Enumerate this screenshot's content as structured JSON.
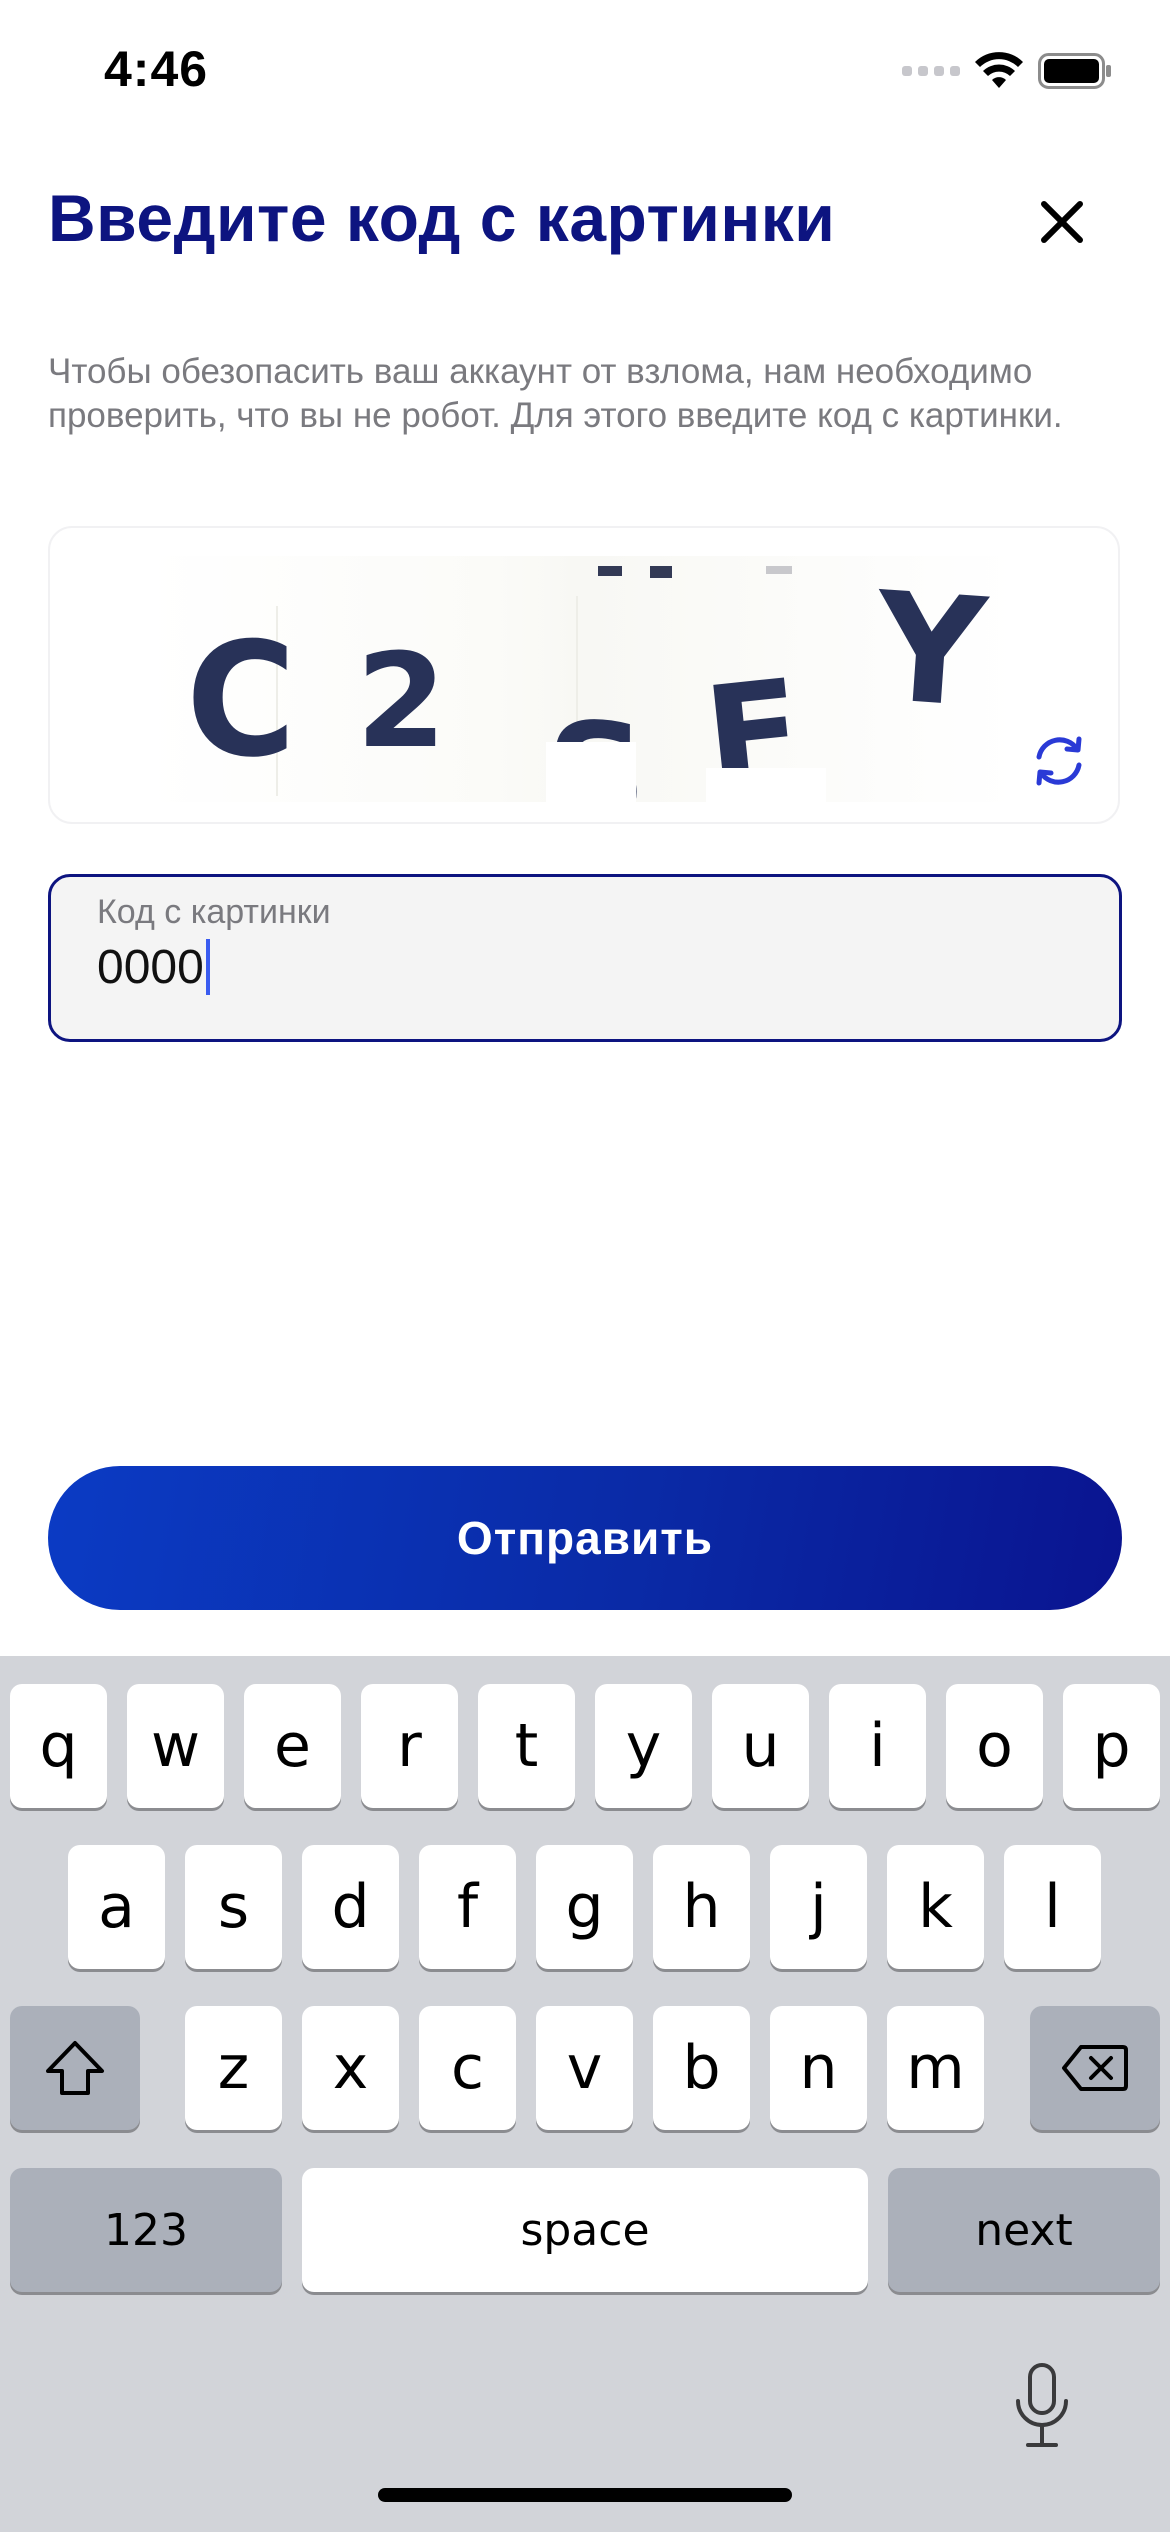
{
  "status_bar": {
    "time": "4:46"
  },
  "header": {
    "title": "Введите код с картинки",
    "close_icon": "close-icon"
  },
  "description": "Чтобы обезопасить ваш аккаунт от взлома, нам необходимо проверить, что вы не робот. Для этого введите код с картинки.",
  "captcha": {
    "image_text": "C2SFY",
    "refresh_icon": "refresh-icon"
  },
  "code_input": {
    "label": "Код с картинки",
    "value": "0000"
  },
  "submit_label": "Отправить",
  "colors": {
    "title": "#0d1480",
    "accent": "#0a2aa6",
    "refresh_icon": "#2a3ad6",
    "caret": "#3a5cf0"
  },
  "keyboard": {
    "row1": [
      "q",
      "w",
      "e",
      "r",
      "t",
      "y",
      "u",
      "i",
      "o",
      "p"
    ],
    "row2": [
      "a",
      "s",
      "d",
      "f",
      "g",
      "h",
      "j",
      "k",
      "l"
    ],
    "row3": [
      "z",
      "x",
      "c",
      "v",
      "b",
      "n",
      "m"
    ],
    "numbers_label": "123",
    "space_label": "space",
    "next_label": "next",
    "shift_icon": "shift-icon",
    "delete_icon": "delete-icon",
    "mic_icon": "microphone-icon"
  }
}
